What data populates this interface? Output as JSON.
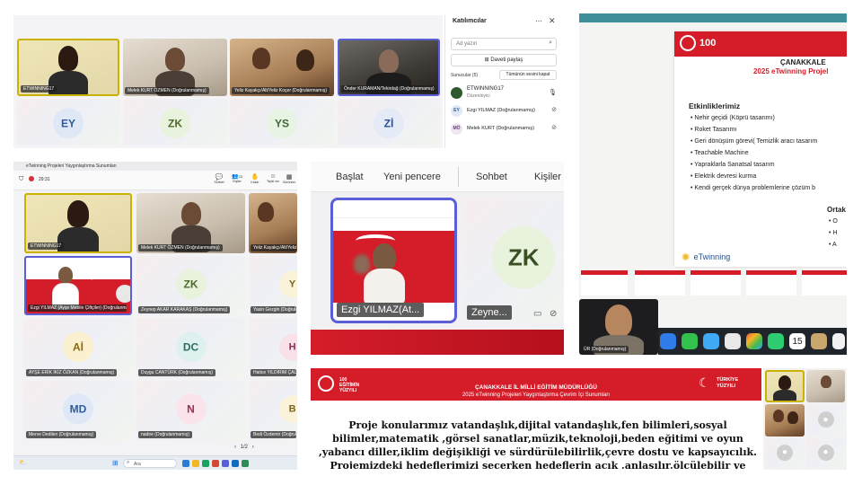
{
  "topleft": {
    "tiles": [
      {
        "name": "ETWINNING17"
      },
      {
        "name": "Melek KURT ÖZMEN (Doğrulanmamış)"
      },
      {
        "name": "Yeliz Kayakçı/Alt/Yeliz Koçer (Doğrulanmamış)"
      },
      {
        "name": "Önder KURAMAN/Tekirdağ (Doğrulanmamış)"
      }
    ],
    "avatars": [
      "EY",
      "ZK",
      "YS",
      "Zİ"
    ]
  },
  "participants": {
    "title": "Katılımcılar",
    "search_placeholder": "Ad yazın",
    "share_invite": "Daveti paylaş",
    "section": "Sunucular (5)",
    "mute_all": "Tümünün sesini kapat",
    "people": [
      {
        "initials": "",
        "name": "ETWINNING17",
        "role": "Düzenleyici"
      },
      {
        "initials": "EY",
        "name": "Ezgi YILMAZ (Doğrulanmamış)",
        "role": ""
      },
      {
        "initials": "MÖ",
        "name": "Melek KURT (Doğrulanmamış)",
        "role": ""
      }
    ]
  },
  "midleft": {
    "window_title": "eTwinning Projeleri Yaygınlaştırma Sunumları",
    "timer": "29:31",
    "toolbar": [
      "Sohbet",
      "Kişiler",
      "Kaldır",
      "Tepki ver",
      "Görünüm"
    ],
    "people_count": "23",
    "row1": [
      {
        "name": "ETWINNING17"
      },
      {
        "name": "Melek KURT ÖZMEN (Doğrulanmamış)"
      },
      {
        "name": "Yeliz Kayakçı/Alt/Yeliz Ko..."
      }
    ],
    "row2": [
      {
        "name": "Ezgi YILMAZ (Ayşe Mebile Çiftçiler) (Doğrulanmamış)"
      },
      {
        "initials": "ZK",
        "name": "Zeynep AKAR KARAKAŞ (Doğrulanmamış)"
      },
      {
        "initials": "Y",
        "name": "Yasin Gezgin (Doğrulanmamış)"
      }
    ],
    "row3": [
      {
        "initials": "Aİ",
        "name": "AYŞE ERİK İKİZ ÖZKAN (Doğrulanmamış)"
      },
      {
        "initials": "DC",
        "name": "Duygu CANTÜRK (Doğrulanmamış)"
      },
      {
        "initials": "H",
        "name": "Hatice YILDIRIM ÇALIŞKAN (Doğrulanmamış)"
      }
    ],
    "row4": [
      {
        "initials": "MD",
        "name": "Merve Dedilen (Doğrulanmamış)"
      },
      {
        "initials": "N",
        "name": "nadire (Doğrulanmamış)"
      },
      {
        "initials": "B",
        "name": "Bedi Özdemir (Doğrulanmamış)"
      }
    ],
    "pager": "1/2",
    "taskbar_search": "Ara"
  },
  "center": {
    "toolbar": [
      "Başlat",
      "Yeni pencere",
      "Sohbet",
      "Kişiler"
    ],
    "tile1_name": "Ezgi YILMAZ(At...",
    "tile2_initials": "ZK",
    "tile2_name": "Zeyne..."
  },
  "rightslide": {
    "banner": "ÇANAKKALE",
    "subtitle": "2025 eTwinning Projel",
    "section": "Etkinliklerimiz",
    "items": [
      "Nehir geçidi (Köprü tasarımı)",
      "Roket Tasarımı",
      "Geri dönüşüm görevi( Temizlik aracı tasarım",
      "Teachable Machine",
      "Yapraklarla Sanatsal tasarım",
      "Elektrik devresi kurma",
      "Kendi gerçek dünya problemlerine çözüm b"
    ],
    "side_head": "Ortak",
    "side_items": [
      "O",
      "H",
      "A"
    ],
    "logo": "eTwinning",
    "speaker_label": "ÜR (Doğrulanmamış)",
    "mac_date": "15"
  },
  "bottomslide": {
    "title": "ÇANAKKALE İL MİLLİ EĞİTİM MÜDÜRLÜĞÜ",
    "subtitle": "2025 eTwinning Projeleri Yaygınlaştırma Çevrim İçi Sunumları",
    "badge_left": "100 EĞİTİMİN YÜZYILI",
    "badge_right": "TÜRKİYE YÜZYILI",
    "body": "Proje konularımız vatandaşlık,dijital vatandaşlık,fen bilimleri,sosyal bilimler,matematik ,görsel sanatlar,müzik,teknoloji,beden eğitimi ve oyun ,yabancı diller,iklim değişikliği ve sürdürülebilirlik,çevre dostu ve kapsayıcılık. Projemizdeki hedeflerimizi seçerken hedeflerin açık ,anlaşılır,ölçülebilir ve"
  },
  "colors": {
    "accent_red": "#d51d2a",
    "teams_purple": "#5a5fd6",
    "speaker_gold": "#c9b200"
  }
}
